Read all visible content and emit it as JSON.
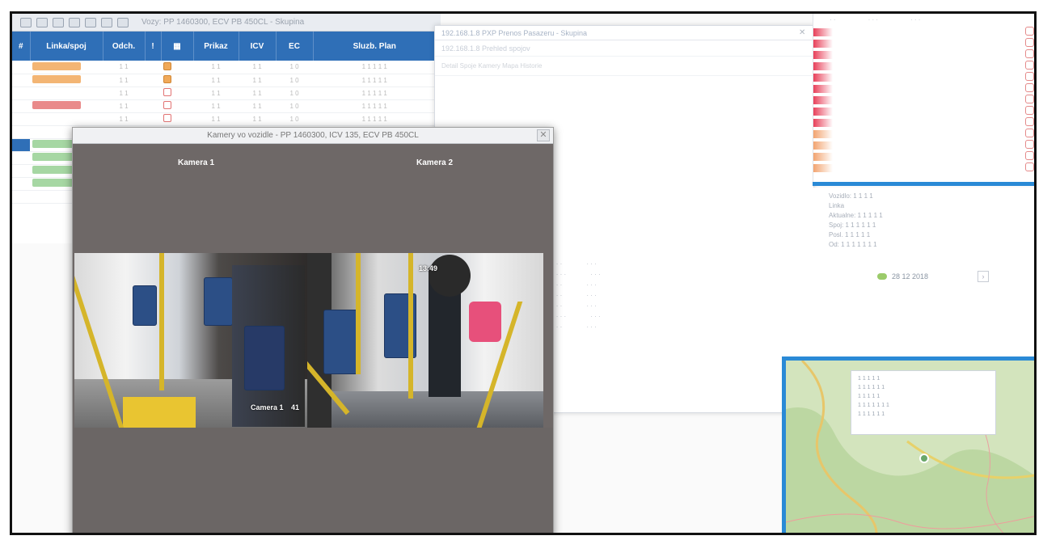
{
  "toolbar": {
    "title": "Vozy: PP 1460300, ECV PB 450CL - Skupina"
  },
  "table": {
    "headers": [
      "#",
      "Linka/spoj",
      "Odch.",
      "!",
      "",
      "Prikaz",
      "ICV",
      "EC",
      "Sluzb. Plan"
    ],
    "rows": [
      {
        "num": "",
        "line": "",
        "a": "1 1",
        "b": "1 1",
        "c": "1 1",
        "d": "1 0",
        "e": "1 1 1 1 1",
        "pill": "orange",
        "sq": "o"
      },
      {
        "num": "",
        "line": "",
        "a": "1 1",
        "b": "1 1",
        "c": "1 1",
        "d": "1 0",
        "e": "1 1 1 1 1",
        "pill": "orange",
        "sq": "o"
      },
      {
        "num": "",
        "line": "",
        "a": "1 1",
        "b": "1 1",
        "c": "1 1",
        "d": "1 0",
        "e": "1 1 1 1 1",
        "pill": "",
        "sq": ""
      },
      {
        "num": "",
        "line": "",
        "a": "1 1",
        "b": "1 1",
        "c": "1 1",
        "d": "1 0",
        "e": "1 1 1 1 1",
        "pill": "red",
        "sq": ""
      },
      {
        "num": "",
        "line": "",
        "a": "1 1",
        "b": "1 1",
        "c": "1 1",
        "d": "1 0",
        "e": "1 1 1 1 1",
        "pill": "",
        "sq": ""
      },
      {
        "num": "",
        "line": "",
        "a": "",
        "b": "",
        "c": "",
        "d": "",
        "e": "",
        "pill": "",
        "sq": ""
      },
      {
        "num": "",
        "line": "",
        "a": "",
        "b": "",
        "c": "",
        "d": "",
        "e": "",
        "pill": "green",
        "sq": ""
      },
      {
        "num": "",
        "line": "",
        "a": "",
        "b": "",
        "c": "",
        "d": "",
        "e": "",
        "pill": "green",
        "sq": ""
      },
      {
        "num": "",
        "line": "",
        "a": "",
        "b": "",
        "c": "",
        "d": "",
        "e": "",
        "pill": "green",
        "sq": ""
      },
      {
        "num": "",
        "line": "",
        "a": "",
        "b": "",
        "c": "",
        "d": "",
        "e": "",
        "pill": "green",
        "sq": ""
      },
      {
        "num": "",
        "line": "",
        "a": "",
        "b": "",
        "c": "",
        "d": "",
        "e": "",
        "pill": "",
        "sq": ""
      }
    ]
  },
  "mid_window": {
    "title": "192.168.1.8 PXP Prenos Pasazeru - Skupina",
    "subtitle": "192.168.1.8 Prehled spojov",
    "tabs": "Detail   Spoje   Kamery   Mapa   Historie"
  },
  "camera_dialog": {
    "title": "Kamery vo vozidle - PP 1460300, ICV 135, ECV PB 450CL",
    "close_label": "✕",
    "cam1_label": "Kamera 1",
    "cam2_label": "Kamera 2",
    "cam1_overlay": "Camera 1",
    "cam1_overlay_ts": "41",
    "cam2_overlay_ts": "13:49"
  },
  "info_panel": {
    "lines": [
      "Vozidlo: 1 1 1 1",
      "Linka",
      "Aktualne: 1 1 1 1 1",
      "Spoj: 1 1 1 1 1 1",
      "Posl. 1 1 1 1 1",
      "Od: 1 1 1 1 1 1 1"
    ],
    "badge": "28 12 2018",
    "nav_label": "›"
  },
  "map": {
    "popup_lines": [
      "1 1 1 1 1",
      "1 1 1 1 1 1",
      "1 1 1 1 1",
      "1 1 1 1 1 1 1",
      "1 1 1 1 1 1"
    ]
  },
  "colors": {
    "header_blue": "#2f6fb7",
    "accent_blue": "#2a8ad6",
    "row_orange": "#f3b574",
    "row_red": "#e98a8a",
    "row_green": "#a6d7a3"
  }
}
